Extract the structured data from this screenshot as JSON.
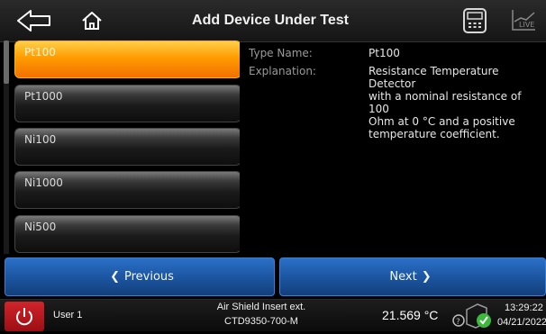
{
  "header": {
    "title": "Add Device Under Test",
    "icons": [
      "back-arrow-icon",
      "home-icon",
      "calculator-icon",
      "live-chart-icon"
    ],
    "live_label": "LIVE"
  },
  "list": {
    "items": [
      {
        "label": "Pt100",
        "selected": true
      },
      {
        "label": "Pt1000",
        "selected": false
      },
      {
        "label": "Ni100",
        "selected": false
      },
      {
        "label": "Ni1000",
        "selected": false
      },
      {
        "label": "Ni500",
        "selected": false
      }
    ]
  },
  "details": {
    "type_label": "Type Name:",
    "type_value": "Pt100",
    "explanation_label": "Explanation:",
    "explanation_lines": [
      "Resistance Temperature Detector",
      "with a nominal resistance of 100",
      "Ohm at 0 °C and a positive",
      "temperature coefficient."
    ]
  },
  "nav": {
    "previous_label": "Previous",
    "next_label": "Next"
  },
  "footer": {
    "user": "User 1",
    "instrument_line1": "Air Shield Insert ext.",
    "instrument_line2": "CTD9350-700-M",
    "temperature": "21.569 °C",
    "time": "13:29:22",
    "date": "04/21/2022"
  },
  "colors": {
    "accent_orange": "#ff9c00",
    "nav_blue": "#1c56a2",
    "power_red": "#d2232a",
    "status_green": "#3cb93c"
  }
}
